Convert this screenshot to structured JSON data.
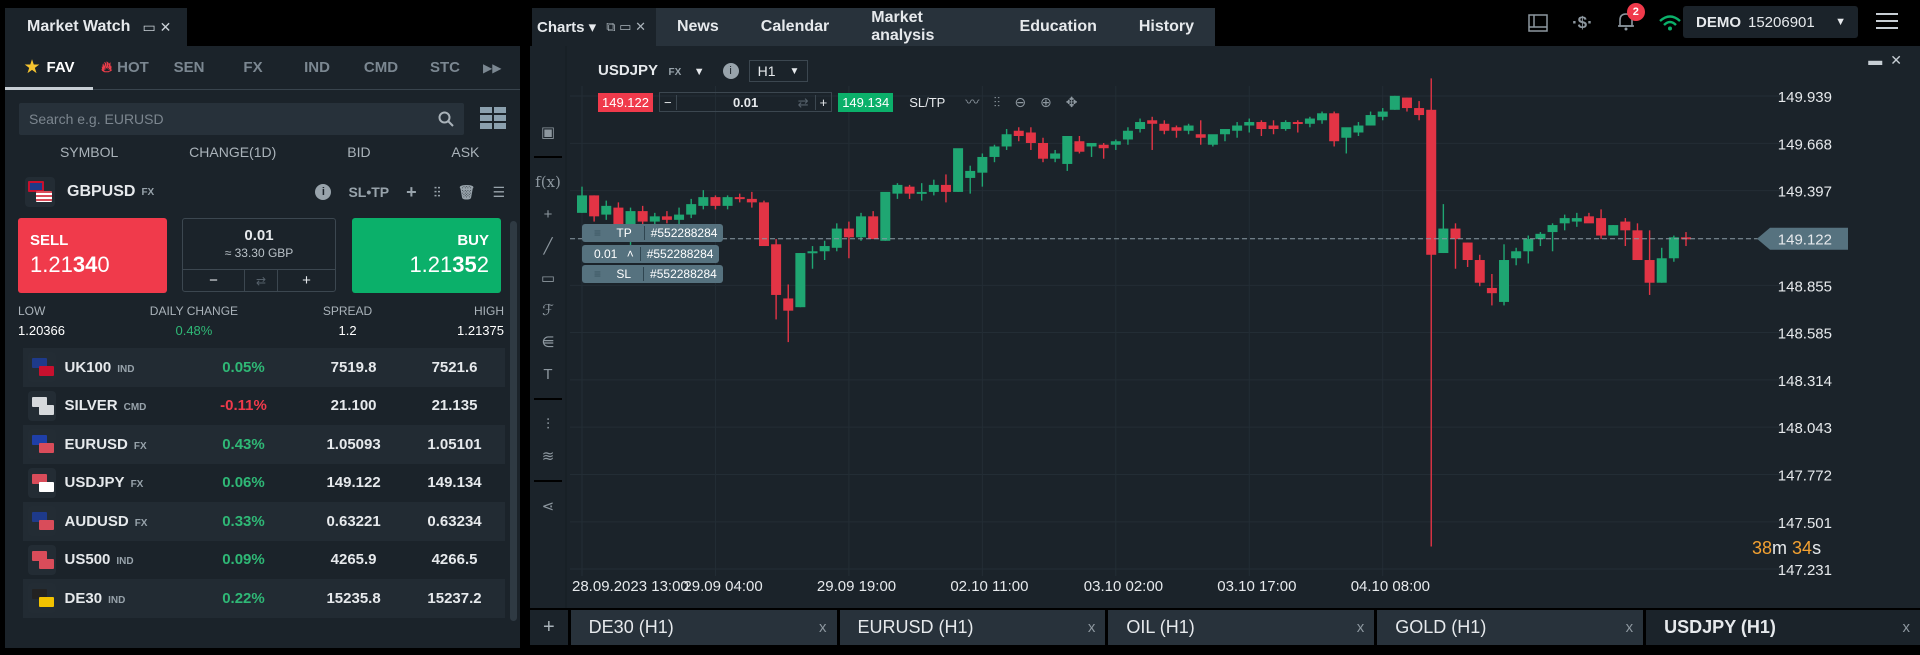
{
  "market_watch": {
    "title": "Market Watch",
    "tabs": [
      {
        "label": "FAV",
        "icon": "star-icon",
        "active": true
      },
      {
        "label": "HOT",
        "icon": "fire-icon"
      },
      {
        "label": "SEN"
      },
      {
        "label": "FX"
      },
      {
        "label": "IND"
      },
      {
        "label": "CMD"
      },
      {
        "label": "STC"
      }
    ],
    "search_placeholder": "Search e.g. EURUSD",
    "columns": [
      "SYMBOL",
      "CHANGE(1D)",
      "BID",
      "ASK"
    ],
    "selected": {
      "symbol": "GBPUSD",
      "class": "FX",
      "tools_label": "SL•TP",
      "sell_label": "SELL",
      "sell_price_pre": "1.21",
      "sell_price_big": "34",
      "sell_price_post": "0",
      "buy_label": "BUY",
      "buy_price_pre": "1.21",
      "buy_price_big": "35",
      "buy_price_post": "2",
      "volume": "0.01",
      "volume_approx": "≈ 33.30 GBP",
      "minus": "−",
      "plus": "+",
      "low_label": "LOW",
      "low": "1.20366",
      "daily_change_label": "DAILY CHANGE",
      "daily_change": "0.48%",
      "spread_label": "SPREAD",
      "spread": "1.2",
      "high_label": "HIGH",
      "high": "1.21375"
    },
    "rows": [
      {
        "symbol": "UK100",
        "class": "IND",
        "change": "0.05%",
        "dir": "up",
        "bid": "7519.8",
        "ask": "7521.6",
        "flag": [
          "#1e3a8a",
          "#c8102e"
        ]
      },
      {
        "symbol": "SILVER",
        "class": "CMD",
        "change": "-0.11%",
        "dir": "down",
        "bid": "21.100",
        "ask": "21.135",
        "flag": [
          "#d6d9dc",
          "#d6d9dc"
        ]
      },
      {
        "symbol": "EURUSD",
        "class": "FX",
        "change": "0.43%",
        "dir": "up",
        "bid": "1.05093",
        "ask": "1.05101",
        "flag": [
          "#1f3fa8",
          "#d94c5a"
        ]
      },
      {
        "symbol": "USDJPY",
        "class": "FX",
        "change": "0.06%",
        "dir": "up",
        "bid": "149.122",
        "ask": "149.134",
        "flag": [
          "#d94c5a",
          "#ffffff"
        ]
      },
      {
        "symbol": "AUDUSD",
        "class": "FX",
        "change": "0.33%",
        "dir": "up",
        "bid": "0.63221",
        "ask": "0.63234",
        "flag": [
          "#1e3a8a",
          "#d94c5a"
        ]
      },
      {
        "symbol": "US500",
        "class": "IND",
        "change": "0.09%",
        "dir": "up",
        "bid": "4265.9",
        "ask": "4266.5",
        "flag": [
          "#d94c5a",
          "#d94c5a"
        ]
      },
      {
        "symbol": "DE30",
        "class": "IND",
        "change": "0.22%",
        "dir": "up",
        "bid": "15235.8",
        "ask": "15237.2",
        "flag": [
          "#222",
          "#f2c200"
        ]
      }
    ]
  },
  "top_tabs": {
    "charts_label": "Charts",
    "tabs": [
      "News",
      "Calendar",
      "Market analysis",
      "Education",
      "History"
    ]
  },
  "status": {
    "notifications_count": "2",
    "account_type": "DEMO",
    "account_number": "15206901"
  },
  "chart": {
    "symbol": "USDJPY",
    "class": "FX",
    "timeframe": "H1",
    "sell_price": "149.122",
    "buy_price": "149.134",
    "volume": "0.01",
    "sltp_label": "SL/TP",
    "order_id": "#552288284",
    "tp_label": "TP",
    "sl_label": "SL",
    "position_volume": "0.01",
    "countdown_min": "38",
    "countdown_min_unit": "m",
    "countdown_sec": "34",
    "countdown_sec_unit": "s"
  },
  "bottom_tabs": [
    {
      "label": "DE30 (H1)"
    },
    {
      "label": "EURUSD (H1)"
    },
    {
      "label": "OIL (H1)"
    },
    {
      "label": "GOLD (H1)"
    },
    {
      "label": "USDJPY (H1)",
      "active": true
    }
  ],
  "colors": {
    "up": "#1fa672",
    "down": "#e23445",
    "change_up": "#2fb876",
    "change_down": "#f03a4b"
  },
  "chart_data": {
    "type": "candlestick",
    "title": "USDJPY H1",
    "ylim": [
      147.231,
      149.97
    ],
    "yticks": [
      "149.939",
      "149.668",
      "149.397",
      "149.122",
      "148.855",
      "148.585",
      "148.314",
      "148.043",
      "147.772",
      "147.501",
      "147.231"
    ],
    "xticks": [
      "28.09.2023 13:00",
      "29.09 04:00",
      "29.09 19:00",
      "02.10 11:00",
      "03.10 02:00",
      "03.10 17:00",
      "04.10 08:00"
    ],
    "current_price": "149.122",
    "ohlc": [
      [
        149.27,
        149.42,
        149.27,
        149.37
      ],
      [
        149.37,
        149.37,
        149.22,
        149.25
      ],
      [
        149.26,
        149.34,
        149.23,
        149.31
      ],
      [
        149.3,
        149.33,
        149.12,
        149.14
      ],
      [
        149.14,
        149.3,
        149.08,
        149.28
      ],
      [
        149.28,
        149.31,
        149.2,
        149.22
      ],
      [
        149.22,
        149.27,
        149.19,
        149.25
      ],
      [
        149.25,
        149.28,
        149.21,
        149.23
      ],
      [
        149.23,
        149.3,
        149.2,
        149.26
      ],
      [
        149.26,
        149.35,
        149.24,
        149.32
      ],
      [
        149.31,
        149.4,
        149.29,
        149.36
      ],
      [
        149.36,
        149.37,
        149.29,
        149.31
      ],
      [
        149.31,
        149.37,
        149.29,
        149.36
      ],
      [
        149.36,
        149.38,
        149.33,
        149.35
      ],
      [
        149.35,
        149.39,
        149.3,
        149.33
      ],
      [
        149.33,
        149.34,
        149.11,
        149.08
      ],
      [
        149.09,
        149.12,
        148.66,
        148.8
      ],
      [
        148.78,
        148.86,
        148.53,
        148.71
      ],
      [
        148.73,
        149.04,
        148.73,
        149.04
      ],
      [
        149.04,
        149.08,
        148.95,
        149.05
      ],
      [
        149.05,
        149.11,
        149.0,
        149.08
      ],
      [
        149.07,
        149.21,
        149.05,
        149.18
      ],
      [
        149.18,
        149.22,
        149.01,
        149.13
      ],
      [
        149.13,
        149.27,
        149.11,
        149.25
      ],
      [
        149.25,
        149.28,
        149.12,
        149.12
      ],
      [
        149.11,
        149.35,
        149.11,
        149.39
      ],
      [
        149.38,
        149.44,
        149.35,
        149.43
      ],
      [
        149.42,
        149.43,
        149.35,
        149.38
      ],
      [
        149.39,
        149.44,
        149.34,
        149.39
      ],
      [
        149.39,
        149.46,
        149.37,
        149.43
      ],
      [
        149.43,
        149.49,
        149.33,
        149.39
      ],
      [
        149.39,
        149.52,
        149.39,
        149.64
      ],
      [
        149.47,
        149.54,
        149.38,
        149.51
      ],
      [
        149.5,
        149.61,
        149.42,
        149.59
      ],
      [
        149.59,
        149.66,
        149.56,
        149.65
      ],
      [
        149.65,
        149.75,
        149.63,
        149.72
      ],
      [
        149.74,
        149.76,
        149.68,
        149.71
      ],
      [
        149.73,
        149.76,
        149.63,
        149.67
      ],
      [
        149.67,
        149.7,
        149.56,
        149.58
      ],
      [
        149.58,
        149.63,
        149.56,
        149.61
      ],
      [
        149.55,
        149.71,
        149.51,
        149.71
      ],
      [
        149.68,
        149.71,
        149.61,
        149.62
      ],
      [
        149.65,
        149.67,
        149.59,
        149.67
      ],
      [
        149.66,
        149.67,
        149.58,
        149.64
      ],
      [
        149.66,
        149.69,
        149.63,
        149.68
      ],
      [
        149.69,
        149.76,
        149.66,
        149.74
      ],
      [
        149.75,
        149.81,
        149.73,
        149.79
      ],
      [
        149.8,
        149.82,
        149.63,
        149.78
      ],
      [
        149.78,
        149.8,
        149.72,
        149.74
      ],
      [
        149.76,
        149.77,
        149.7,
        149.74
      ],
      [
        149.74,
        149.78,
        149.72,
        149.77
      ],
      [
        149.72,
        149.8,
        149.66,
        149.7
      ],
      [
        149.66,
        149.71,
        149.65,
        149.72
      ],
      [
        149.72,
        149.75,
        149.68,
        149.75
      ],
      [
        149.74,
        149.79,
        149.7,
        149.77
      ],
      [
        149.77,
        149.81,
        149.73,
        149.79
      ],
      [
        149.79,
        149.8,
        149.71,
        149.75
      ],
      [
        149.77,
        149.8,
        149.72,
        149.75
      ],
      [
        149.75,
        149.8,
        149.74,
        149.79
      ],
      [
        149.79,
        149.8,
        149.73,
        149.78
      ],
      [
        149.78,
        149.82,
        149.76,
        149.81
      ],
      [
        149.8,
        149.85,
        149.78,
        149.84
      ],
      [
        149.84,
        149.85,
        149.65,
        149.68
      ],
      [
        149.7,
        149.75,
        149.61,
        149.76
      ],
      [
        149.73,
        149.79,
        149.71,
        149.77
      ],
      [
        149.77,
        149.85,
        149.77,
        149.83
      ],
      [
        149.82,
        149.87,
        149.8,
        149.85
      ],
      [
        149.86,
        149.94,
        149.86,
        149.94
      ],
      [
        149.93,
        149.93,
        149.85,
        149.87
      ],
      [
        149.87,
        149.91,
        149.8,
        149.83
      ],
      [
        149.86,
        150.04,
        147.36,
        149.03
      ],
      [
        149.04,
        149.32,
        149.04,
        149.18
      ],
      [
        149.18,
        149.21,
        148.95,
        149.12
      ],
      [
        149.1,
        149.1,
        148.96,
        149.0
      ],
      [
        149.0,
        149.03,
        148.85,
        148.87
      ],
      [
        148.84,
        148.92,
        148.74,
        148.81
      ],
      [
        148.76,
        149.09,
        148.74,
        149.0
      ],
      [
        149.01,
        149.07,
        148.97,
        149.05
      ],
      [
        149.05,
        149.14,
        148.98,
        149.12
      ],
      [
        149.12,
        149.16,
        149.08,
        149.15
      ],
      [
        149.16,
        149.21,
        149.05,
        149.2
      ],
      [
        149.21,
        149.26,
        149.17,
        149.24
      ],
      [
        149.22,
        149.27,
        149.19,
        149.24
      ],
      [
        149.25,
        149.27,
        149.22,
        149.21
      ],
      [
        149.24,
        149.29,
        149.12,
        149.14
      ],
      [
        149.14,
        149.2,
        149.18,
        149.2
      ],
      [
        149.22,
        149.24,
        149.08,
        149.17
      ],
      [
        149.17,
        149.21,
        149.06,
        149.0
      ],
      [
        149.0,
        149.17,
        148.8,
        148.87
      ],
      [
        148.87,
        149.07,
        148.87,
        149.01
      ],
      [
        149.01,
        149.14,
        148.99,
        149.13
      ],
      [
        149.13,
        149.16,
        149.08,
        149.12
      ]
    ]
  }
}
